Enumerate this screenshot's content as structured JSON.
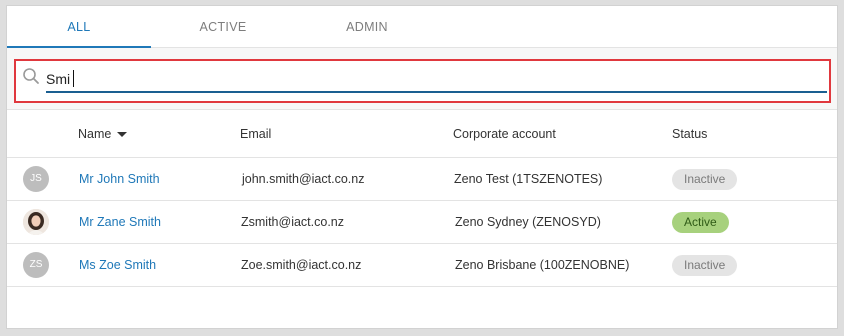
{
  "tabs": [
    {
      "label": "ALL",
      "selected": true
    },
    {
      "label": "ACTIVE",
      "selected": false
    },
    {
      "label": "ADMIN",
      "selected": false
    }
  ],
  "search": {
    "value": "Smi",
    "icon": "search-icon"
  },
  "table": {
    "columns": {
      "name": "Name",
      "email": "Email",
      "corporate": "Corporate account",
      "status": "Status"
    },
    "rows": [
      {
        "initials": "JS",
        "avatar": "initials",
        "name": "Mr John Smith",
        "email": "john.smith@iact.co.nz",
        "corporate": "Zeno Test (1TSZENOTES)",
        "status": "Inactive"
      },
      {
        "initials": "",
        "avatar": "photo",
        "name": "Mr Zane Smith",
        "email": "Zsmith@iact.co.nz",
        "corporate": "Zeno Sydney (ZENOSYD)",
        "status": "Active"
      },
      {
        "initials": "ZS",
        "avatar": "initials",
        "name": "Ms Zoe Smith",
        "email": "Zoe.smith@iact.co.nz",
        "corporate": "Zeno Brisbane (100ZENOBNE)",
        "status": "Inactive"
      }
    ]
  },
  "colors": {
    "accent": "#1f78b8",
    "search_border": "#e0383e",
    "active_badge": "#a7d17d",
    "inactive_badge": "#e4e4e4"
  }
}
